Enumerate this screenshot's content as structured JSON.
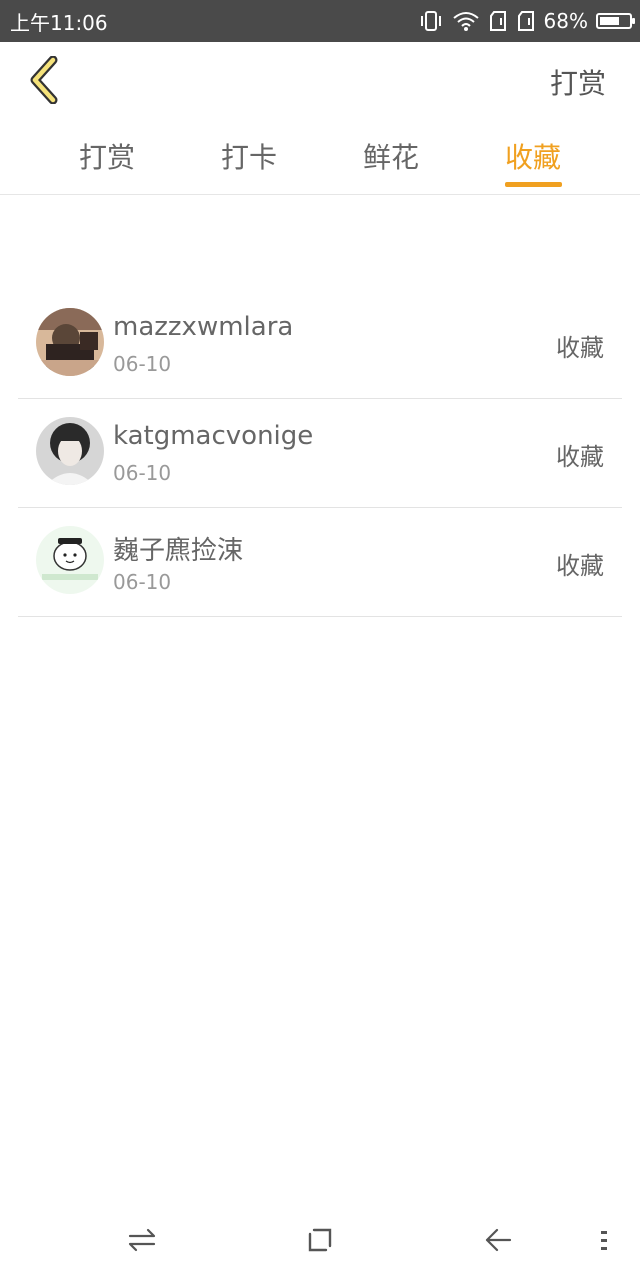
{
  "status_bar": {
    "time": "上午11:06",
    "battery_percent": "68%",
    "battery_level": 0.68
  },
  "header": {
    "action_label": "打赏",
    "back_icon": "chevron-left-icon",
    "accent_color": "#f0a020"
  },
  "tabs": [
    {
      "label": "打赏"
    },
    {
      "label": "打卡"
    },
    {
      "label": "鲜花"
    },
    {
      "label": "收藏"
    }
  ],
  "active_tab_index": 3,
  "list": [
    {
      "name": "mazzxwmlara",
      "date": "06-10",
      "action": "收藏"
    },
    {
      "name": "katgmacvonige",
      "date": "06-10",
      "action": "收藏"
    },
    {
      "name": "巍子麃捡涑",
      "date": "06-10",
      "action": "收藏"
    }
  ],
  "nav_bar": {
    "icons": [
      "switch-icon",
      "home-icon",
      "back-icon",
      "menu-icon"
    ]
  }
}
